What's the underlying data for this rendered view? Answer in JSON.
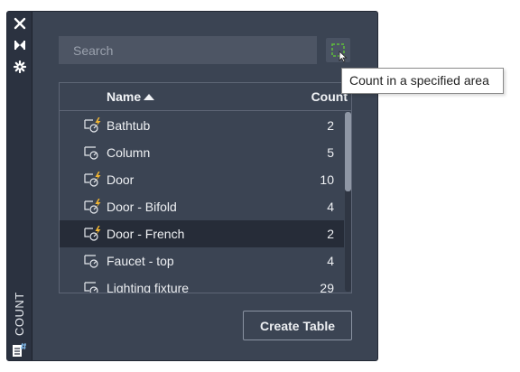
{
  "palette": {
    "title": "COUNT",
    "strip_icons": [
      "close-icon",
      "collapse-icon",
      "settings-icon",
      "count-table-icon"
    ]
  },
  "search": {
    "placeholder": "Search",
    "value": ""
  },
  "toolbar": {
    "area_icon": "count-area-icon"
  },
  "tooltip": {
    "text": "Count in a specified area"
  },
  "table": {
    "columns": {
      "name": "Name",
      "count": "Count",
      "sort": "ascending"
    },
    "rows": [
      {
        "name": "Bathtub",
        "count": "2",
        "icon": "dynamic-block-icon",
        "selected": false
      },
      {
        "name": "Column",
        "count": "5",
        "icon": "block-icon",
        "selected": false
      },
      {
        "name": "Door",
        "count": "10",
        "icon": "dynamic-block-icon",
        "selected": false
      },
      {
        "name": "Door - Bifold",
        "count": "4",
        "icon": "dynamic-block-icon",
        "selected": false
      },
      {
        "name": "Door - French",
        "count": "2",
        "icon": "dynamic-block-icon",
        "selected": true
      },
      {
        "name": "Faucet - top",
        "count": "4",
        "icon": "block-icon",
        "selected": false
      },
      {
        "name": "Lighting fixture",
        "count": "29",
        "icon": "block-icon",
        "selected": false
      }
    ]
  },
  "actions": {
    "create_table": "Create Table"
  },
  "colors": {
    "panel": "#3b4453",
    "strip": "#2b3240",
    "selected_row": "#262c38",
    "accent_green": "#5fbf3a",
    "lightning": "#f2b632"
  }
}
